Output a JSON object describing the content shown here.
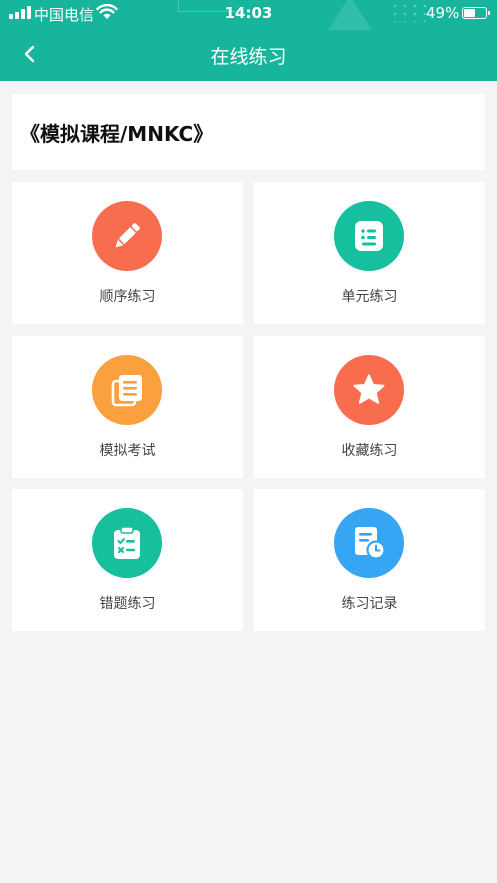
{
  "status_bar": {
    "carrier": "中国电信",
    "time": "14:03",
    "battery": "49%",
    "battery_level": 0.49
  },
  "header": {
    "title": "在线练习",
    "back_icon": "chevron-left-icon"
  },
  "course": {
    "title": "《模拟课程/MNKC》"
  },
  "tiles": [
    {
      "label": "顺序练习",
      "icon": "pencil-icon",
      "color": "#f86d4e"
    },
    {
      "label": "单元练习",
      "icon": "list-document-icon",
      "color": "#16bf9e"
    },
    {
      "label": "模拟考试",
      "icon": "stacked-documents-icon",
      "color": "#faa03f"
    },
    {
      "label": "收藏练习",
      "icon": "star-icon",
      "color": "#f86d4e"
    },
    {
      "label": "错题练习",
      "icon": "clipboard-checklist-icon",
      "color": "#16bf9e"
    },
    {
      "label": "练习记录",
      "icon": "document-clock-icon",
      "color": "#36a5f4"
    }
  ],
  "colors": {
    "header": "#16b59c",
    "background": "#f4f4f5"
  }
}
